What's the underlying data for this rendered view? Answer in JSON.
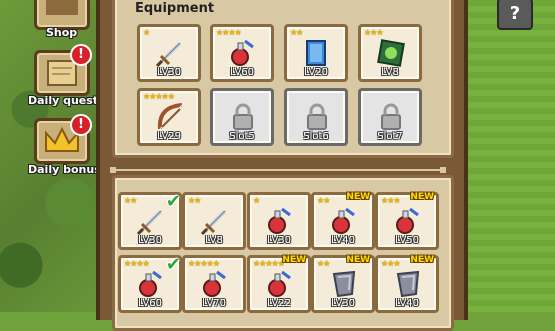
{
  "side_menu": {
    "shop_label": "Shop",
    "daily_quest_label": "Daily quest",
    "daily_bonus_label": "Daily bonus",
    "alert_symbol": "!"
  },
  "help_label": "?",
  "equipment": {
    "title": "Equipment",
    "slots": [
      {
        "icon": "sword-icon",
        "stars": "★",
        "label": "LV30"
      },
      {
        "icon": "potion-icon",
        "stars": "★★★★",
        "label": "LV60"
      },
      {
        "icon": "book-icon",
        "stars": "★★",
        "label": "LV20"
      },
      {
        "icon": "spellbook-icon",
        "stars": "★★★",
        "label": "LV8"
      },
      {
        "icon": "bow-icon",
        "stars": "★★★★★",
        "label": "LV29"
      },
      {
        "icon": "lock-icon",
        "stars": "",
        "label": "Slot5"
      },
      {
        "icon": "lock-icon",
        "stars": "",
        "label": "Slot6"
      },
      {
        "icon": "lock-icon",
        "stars": "",
        "label": "Slot7"
      }
    ]
  },
  "inventory": {
    "new_tag": "NEW",
    "check_mark": "✔",
    "items": [
      {
        "icon": "sword-icon",
        "stars": "★★",
        "label": "LV30",
        "check": true,
        "new": false
      },
      {
        "icon": "sword-icon",
        "stars": "★★",
        "label": "LV8",
        "check": false,
        "new": false
      },
      {
        "icon": "potion-icon",
        "stars": "★",
        "label": "LV30",
        "check": false,
        "new": false
      },
      {
        "icon": "potion-icon",
        "stars": "★★",
        "label": "LV40",
        "check": false,
        "new": true
      },
      {
        "icon": "potion-icon",
        "stars": "★★★",
        "label": "LV50",
        "check": false,
        "new": true
      },
      {
        "icon": "potion-icon",
        "stars": "★★★★",
        "label": "LV60",
        "check": true,
        "new": false
      },
      {
        "icon": "potion-icon",
        "stars": "★★★★★",
        "label": "LV70",
        "check": false,
        "new": false
      },
      {
        "icon": "potion-icon",
        "stars": "★★★★★",
        "label": "LV22",
        "check": false,
        "new": true
      },
      {
        "icon": "shield-icon",
        "stars": "★★",
        "label": "LV30",
        "check": false,
        "new": true
      },
      {
        "icon": "shield-icon",
        "stars": "★★★",
        "label": "LV40",
        "check": false,
        "new": true
      }
    ]
  },
  "colors": {
    "star": "#f0b800",
    "alert": "#d8202a",
    "new": "#f8e000",
    "check": "#2fa83a"
  }
}
